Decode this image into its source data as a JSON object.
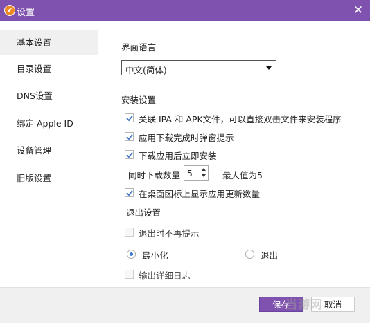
{
  "window": {
    "title": "设置",
    "brand_color": "#7e52ae"
  },
  "icons": {
    "app": "app-logo-icon",
    "close": "close-icon"
  },
  "close_glyph": "✕",
  "sidebar": {
    "items": [
      {
        "label": "基本设置",
        "active": true
      },
      {
        "label": "目录设置",
        "active": false
      },
      {
        "label": "DNS设置",
        "active": false
      },
      {
        "label": "绑定 Apple ID",
        "active": false
      },
      {
        "label": "设备管理",
        "active": false
      },
      {
        "label": "旧版设置",
        "active": false
      }
    ]
  },
  "language": {
    "heading": "界面语言",
    "selected": "中文(简体)"
  },
  "install": {
    "heading": "安装设置",
    "options": [
      {
        "label": "关联 IPA 和 APK文件，可以直接双击文件来安装程序",
        "checked": true
      },
      {
        "label": "应用下载完成时弹窗提示",
        "checked": true
      },
      {
        "label": "下载应用后立即安装",
        "checked": true
      }
    ],
    "concurrent_label": "同时下载数量",
    "concurrent_value": "5",
    "max_label": "最大值为5",
    "show_update_count": {
      "label": "在桌面图标上显示应用更新数量",
      "checked": true
    }
  },
  "exit": {
    "heading": "退出设置",
    "no_prompt": {
      "label": "退出时不再提示",
      "checked": false
    },
    "radios": [
      {
        "label": "最小化",
        "selected": true
      },
      {
        "label": "退出",
        "selected": false
      }
    ],
    "verbose_log": {
      "label": "输出详细日志",
      "checked": false
    }
  },
  "footer": {
    "save": "保存",
    "cancel": "取消"
  },
  "watermark": "当游网"
}
